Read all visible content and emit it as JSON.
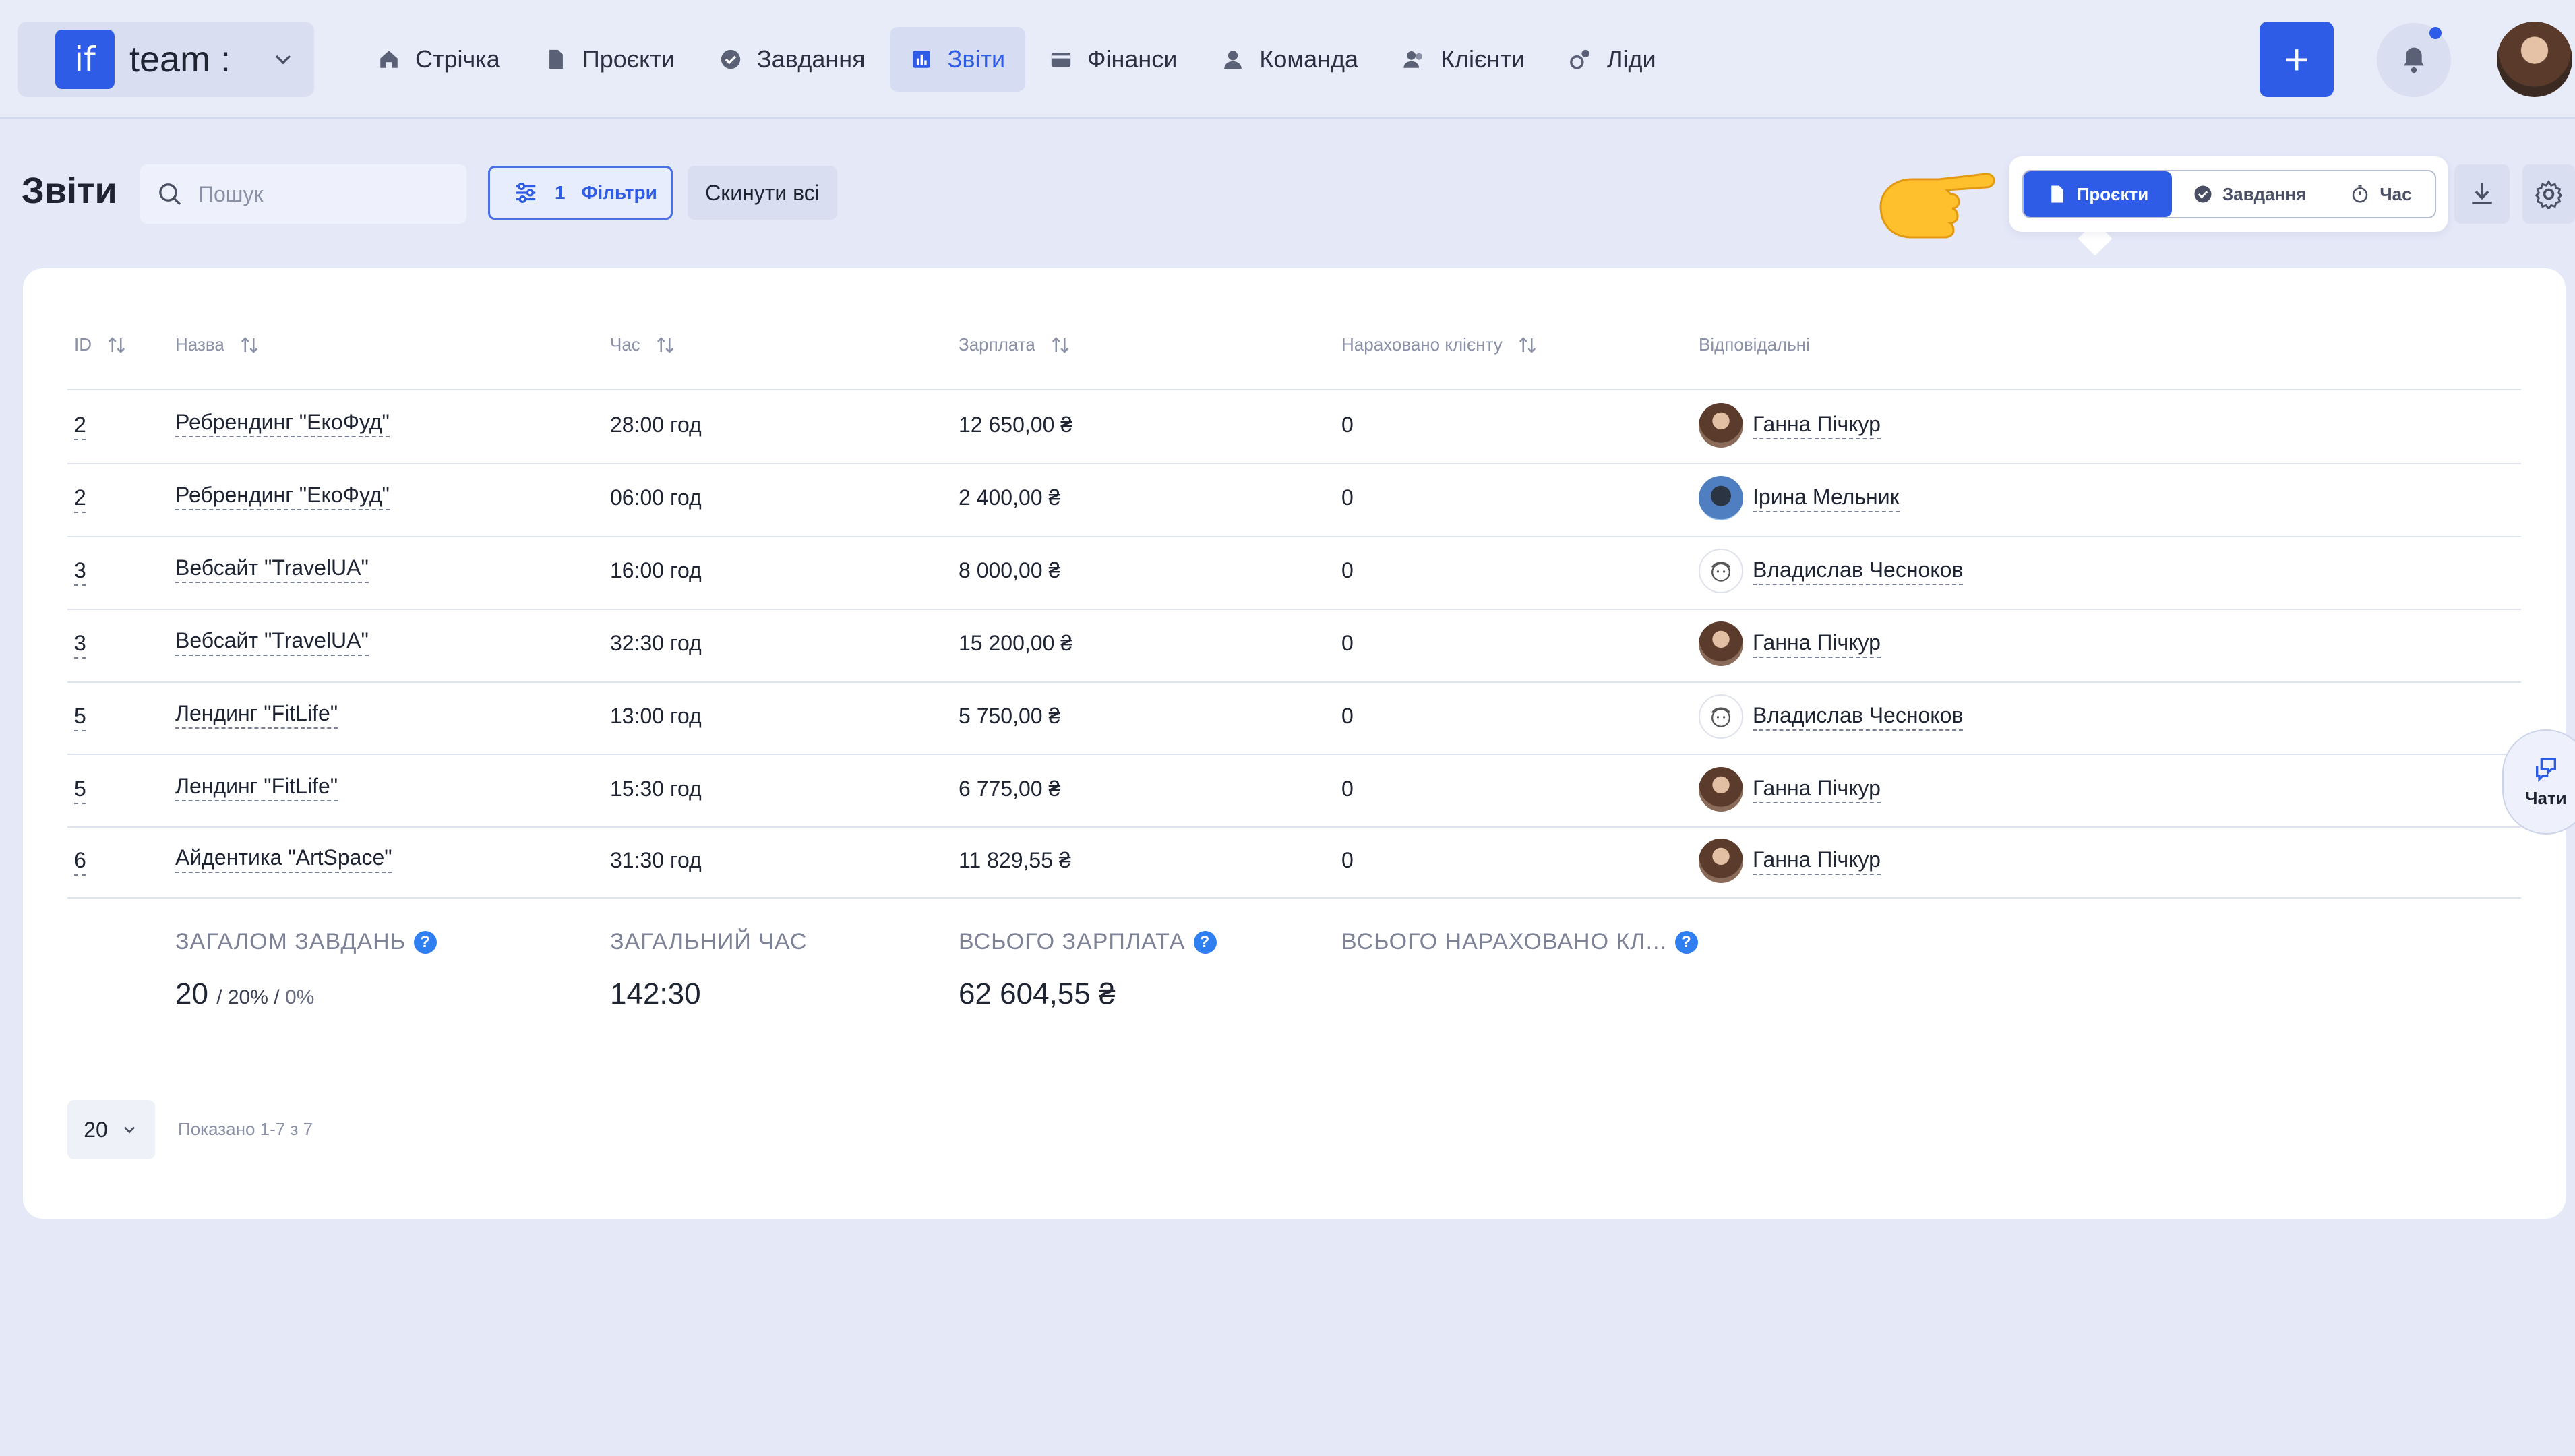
{
  "brand": {
    "logo_text": "if",
    "name": "team :"
  },
  "nav": [
    {
      "label": "Стрічка",
      "icon": "home-icon"
    },
    {
      "label": "Проєкти",
      "icon": "document-icon"
    },
    {
      "label": "Завдання",
      "icon": "check-circle-icon"
    },
    {
      "label": "Звіти",
      "icon": "bar-chart-icon",
      "active": true
    },
    {
      "label": "Фінанси",
      "icon": "wallet-icon"
    },
    {
      "label": "Команда",
      "icon": "user-icon"
    },
    {
      "label": "Клієнти",
      "icon": "users-icon"
    },
    {
      "label": "Ліди",
      "icon": "leads-icon"
    }
  ],
  "header": {
    "plus": "+",
    "notification_dot": true
  },
  "page": {
    "title": "Звіти"
  },
  "search": {
    "placeholder": "Пошук",
    "value": ""
  },
  "filters": {
    "count": "1",
    "label": "Фільтри",
    "reset_label": "Скинути всі"
  },
  "view_switch": [
    {
      "label": "Проєкти",
      "icon": "document-icon",
      "active": true
    },
    {
      "label": "Завдання",
      "icon": "check-circle-icon"
    },
    {
      "label": "Час",
      "icon": "stopwatch-icon"
    }
  ],
  "table": {
    "columns": [
      "ID",
      "Назва",
      "Час",
      "Зарплата",
      "Нараховано клієнту",
      "Відповідальні"
    ],
    "rows": [
      {
        "id": "2",
        "name": "Ребрендинг \"ЕкоФуд\"",
        "time": "28:00 год",
        "salary": "12 650,00 ₴",
        "charged": "0",
        "responsible": "Ганна Пічкур",
        "avatar": "hanna"
      },
      {
        "id": "2",
        "name": "Ребрендинг \"ЕкоФуд\"",
        "time": "06:00 год",
        "salary": "2 400,00 ₴",
        "charged": "0",
        "responsible": "Ірина Мельник",
        "avatar": "iryna"
      },
      {
        "id": "3",
        "name": "Вебсайт \"TravelUA\"",
        "time": "16:00 год",
        "salary": "8 000,00 ₴",
        "charged": "0",
        "responsible": "Владислав Чесноков",
        "avatar": "vlad"
      },
      {
        "id": "3",
        "name": "Вебсайт \"TravelUA\"",
        "time": "32:30 год",
        "salary": "15 200,00 ₴",
        "charged": "0",
        "responsible": "Ганна Пічкур",
        "avatar": "hanna"
      },
      {
        "id": "5",
        "name": "Лендинг \"FitLife\"",
        "time": "13:00 год",
        "salary": "5 750,00 ₴",
        "charged": "0",
        "responsible": "Владислав Чесноков",
        "avatar": "vlad"
      },
      {
        "id": "5",
        "name": "Лендинг \"FitLife\"",
        "time": "15:30 год",
        "salary": "6 775,00 ₴",
        "charged": "0",
        "responsible": "Ганна Пічкур",
        "avatar": "hanna"
      },
      {
        "id": "6",
        "name": "Айдентика \"ArtSpace\"",
        "time": "31:30 год",
        "salary": "11 829,55 ₴",
        "charged": "0",
        "responsible": "Ганна Пічкур",
        "avatar": "hanna"
      }
    ]
  },
  "summary": {
    "tasks_label": "ЗАГАЛОМ ЗАВДАНЬ",
    "tasks_value": "20",
    "tasks_sep1": "/",
    "tasks_pct1": "20%",
    "tasks_sep2": "/",
    "tasks_pct2": "0%",
    "time_label": "ЗАГАЛЬНИЙ ЧАС",
    "time_value": "142:30",
    "salary_label": "ВСЬОГО ЗАРПЛАТА",
    "salary_value": "62 604,55 ₴",
    "charged_label": "ВСЬОГО НАРАХОВАНО КЛ...",
    "help": "?"
  },
  "pagination": {
    "per_page": "20",
    "info": "Показано 1-7 з 7"
  },
  "chat": {
    "label": "Чати"
  }
}
